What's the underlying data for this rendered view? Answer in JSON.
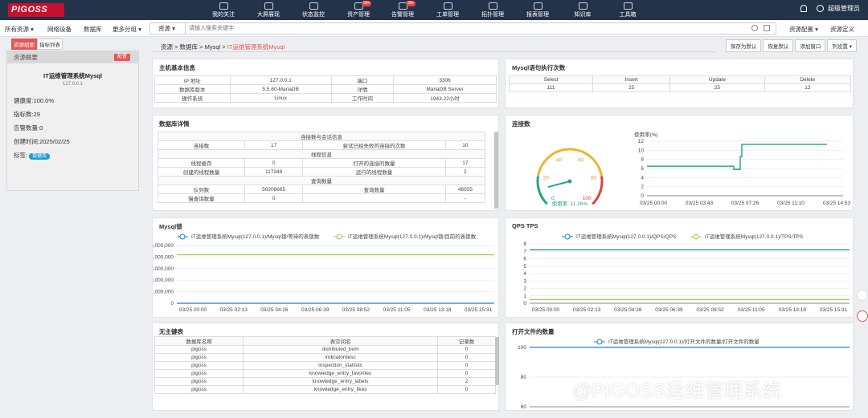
{
  "app": {
    "logo_text": "PIGOSS",
    "user": "超级管理员"
  },
  "nav": [
    {
      "label": "我的关注"
    },
    {
      "label": "大屏展现"
    },
    {
      "label": "状态监控"
    },
    {
      "label": "资产管理",
      "badge": "99+"
    },
    {
      "label": "告警管理",
      "badge": "99+"
    },
    {
      "label": "工单管理"
    },
    {
      "label": "拓扑管理"
    },
    {
      "label": "报表管理"
    },
    {
      "label": "知识库"
    },
    {
      "label": "工具箱"
    }
  ],
  "toolbar": {
    "items": [
      "所有资源 ▾",
      "网络设备",
      "数据库",
      "更多分组 ▾"
    ],
    "search_type": "资源",
    "search_placeholder": "请输入搜索关键字",
    "resource_config": "资源配置 ▾",
    "resource_def": "资源定义"
  },
  "side_tabs": [
    "资源组图",
    "指标列表"
  ],
  "left_panel": {
    "header": "资源概要",
    "config_btn": "配置",
    "title": "IT运维管理系统Mysql",
    "ip": "127.0.0.1",
    "health": "健康度:100.0%",
    "metrics": "指标数:29",
    "alarms": "告警数量:0",
    "created": "创建时间:2025/02/25",
    "tag_label": "标签:",
    "tag": "数据库"
  },
  "breadcrumb": {
    "path": "资源 > 数据库 > Mysql > ",
    "current": "IT运维管理系统Mysql"
  },
  "actions": [
    "保存为默认",
    "恢复默认",
    "添加窗口",
    "列设置 ▾"
  ],
  "host_info": {
    "title": "主机基本信息",
    "rows": [
      [
        "IP 地址",
        "127.0.0.1",
        "端口",
        "3306"
      ],
      [
        "数据库版本",
        "5.5.60-MariaDB",
        "详情",
        "MariaDB Server"
      ],
      [
        "操作系统",
        "Linux",
        "工作时间",
        "1943.22小时"
      ]
    ]
  },
  "exec_counts": {
    "title": "Mysql语句执行次数",
    "headers": [
      "Select",
      "Insert",
      "Update",
      "Delete"
    ],
    "values": [
      "111",
      "25",
      "25",
      "12"
    ]
  },
  "db_detail": {
    "title": "数据库详情",
    "sections": [
      {
        "header": "连接数与会话信息",
        "rows": [
          [
            "连接数",
            "17",
            "尝试已经失败的连接的次数",
            "10"
          ]
        ]
      },
      {
        "header": "线程信息",
        "rows": [
          [
            "线程缓存",
            "0",
            "打开的连接的数量",
            "17"
          ],
          [
            "创建的线程数量",
            "117348",
            "运行的线程数量",
            "2"
          ]
        ]
      },
      {
        "header": "查询数量",
        "rows": [
          [
            "队列数",
            "50208665",
            "查询数量",
            "46055"
          ],
          [
            "慢查询数量",
            "0",
            "",
            "-"
          ]
        ]
      }
    ]
  },
  "connections": {
    "title": "连接数",
    "gauge": {
      "value": 11.26,
      "label": "使用率: 11.26%",
      "ticks": [
        "0",
        "20",
        "40",
        "60",
        "80",
        "100"
      ]
    },
    "line": {
      "ylabel": "使用率(%)",
      "yticks": [
        "0",
        "2",
        "4",
        "6",
        "8",
        "10",
        "12"
      ],
      "xticks": [
        "03/25 00:00",
        "03/25 03:43",
        "03/25 07:26",
        "03/25 11:10",
        "03/25 14:53"
      ]
    }
  },
  "mysql_lock": {
    "title": "Mysql锁",
    "legend": [
      "IT运维管理系统Mysql(127.0.0.1)/Mysql锁/等待的表锁数",
      "IT运维管理系统Mysql(127.0.0.1)/Mysql锁/目前的表锁数"
    ],
    "yticks": [
      "0",
      "1,000,000",
      "2,000,000",
      "3,000,000",
      "4,000,000",
      "5,000,000"
    ],
    "xticks": [
      "03/25 00:00",
      "03/25 02:13",
      "03/25 04:26",
      "03/25 06:39",
      "03/25 08:52",
      "03/25 11:05",
      "03/25 13:18",
      "03/25 15:31"
    ]
  },
  "qps": {
    "title": "QPS TPS",
    "legend": [
      "IT运维管理系统Mysql(127.0.0.1)/QPS/QPS",
      "IT运维管理系统Mysql(127.0.0.1)/TPS/TPS"
    ],
    "yticks": [
      "0",
      "1",
      "2",
      "3",
      "4",
      "5",
      "6",
      "7",
      "8"
    ],
    "xticks": [
      "03/25 00:00",
      "03/25 02:13",
      "03/25 04:26",
      "03/25 06:39",
      "03/25 08:52",
      "03/25 11:05",
      "03/25 13:18",
      "03/25 15:31"
    ]
  },
  "no_pk": {
    "title": "无主键表",
    "headers": [
      "数据库名称",
      "表空间名",
      "记录数"
    ],
    "rows": [
      [
        "pigoss",
        "distributed_bom",
        "0"
      ],
      [
        "pigoss",
        "indicatordesc",
        "0"
      ],
      [
        "pigoss",
        "inspection_statistic",
        "0"
      ],
      [
        "pigoss",
        "knowledge_entry_favorites",
        "0"
      ],
      [
        "pigoss",
        "knowledge_entry_labels",
        "2"
      ],
      [
        "pigoss",
        "knowledge_entry_likes",
        "0"
      ]
    ]
  },
  "open_files": {
    "title": "打开文件的数量",
    "legend": "IT运维管理系统Mysql(127.0.0.1)/打开文件的数量/打开文件的数量",
    "yticks": [
      "60",
      "80",
      "100"
    ]
  },
  "watermark": "@PIGOSS运维管理系统",
  "chart_data": [
    {
      "type": "line",
      "title": "连接数",
      "ylabel": "使用率(%)",
      "x": [
        "03/25 00:00",
        "03/25 07:26",
        "03/25 07:40",
        "03/25 08:00",
        "03/25 16:00"
      ],
      "values": [
        6.5,
        6.5,
        5.8,
        11.3,
        11.3
      ],
      "ylim": [
        0,
        12
      ]
    },
    {
      "type": "line",
      "title": "Mysql锁",
      "series": [
        {
          "name": "IT运维管理系统Mysql(127.0.0.1)/Mysql锁/等待的表锁数",
          "values": [
            0,
            0
          ]
        },
        {
          "name": "IT运维管理系统Mysql(127.0.0.1)/Mysql锁/目前的表锁数",
          "values": [
            4200000,
            4200000
          ]
        }
      ],
      "ylim": [
        0,
        5000000
      ]
    },
    {
      "type": "line",
      "title": "QPS TPS",
      "series": [
        {
          "name": "IT运维管理系统Mysql(127.0.0.1)/QPS/QPS",
          "values": [
            7.2,
            7.2
          ]
        },
        {
          "name": "IT运维管理系统Mysql(127.0.0.1)/TPS/TPS",
          "values": [
            0.5,
            0.5
          ]
        }
      ],
      "ylim": [
        0,
        8
      ]
    },
    {
      "type": "line",
      "title": "打开文件的数量",
      "series": [
        {
          "name": "IT运维管理系统Mysql(127.0.0.1)/打开文件的数量/打开文件的数量",
          "values": [
            100,
            100
          ]
        }
      ],
      "ylim": [
        60,
        100
      ]
    }
  ],
  "colors": {
    "topbar": "#22334a",
    "accent": "#e45757",
    "blue_line": "#1e7fd0",
    "green_line": "#9bd04b",
    "teal_line": "#1aa28a"
  }
}
